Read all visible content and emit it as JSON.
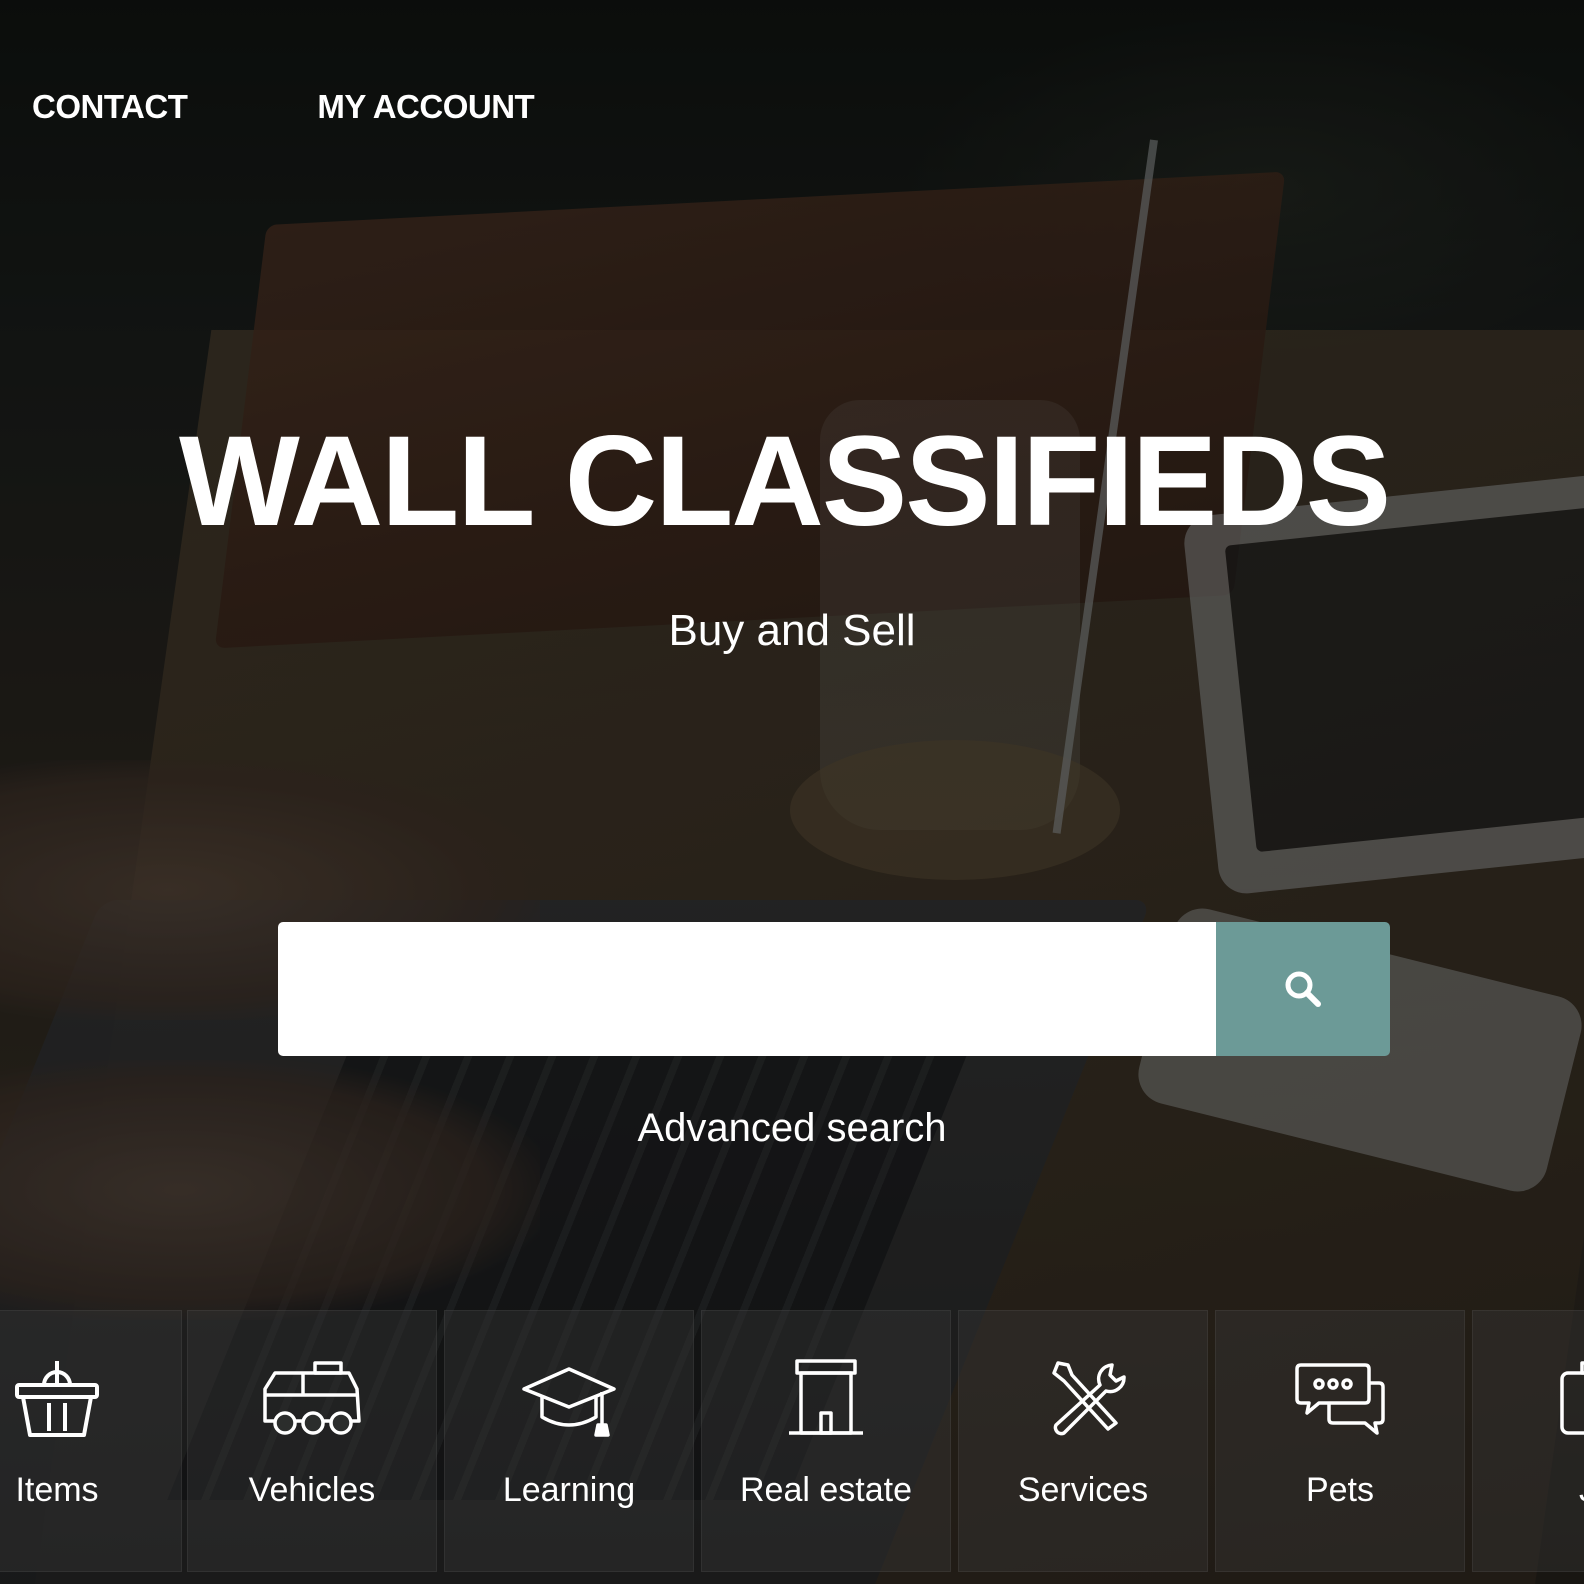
{
  "nav": {
    "contact_label": "CONTACT",
    "account_label": "MY ACCOUNT"
  },
  "hero": {
    "title": "WALL CLASSIFIEDS",
    "tagline": "Buy and Sell"
  },
  "search": {
    "value": "",
    "placeholder": "",
    "button_icon": "search-icon",
    "advanced_label": "Advanced search"
  },
  "categories": [
    {
      "label": "Items",
      "icon": "basket-icon"
    },
    {
      "label": "Vehicles",
      "icon": "car-icon"
    },
    {
      "label": "Learning",
      "icon": "graduation-cap-icon"
    },
    {
      "label": "Real estate",
      "icon": "building-icon"
    },
    {
      "label": "Services",
      "icon": "tools-icon"
    },
    {
      "label": "Pets",
      "icon": "chat-bubbles-icon"
    },
    {
      "label": "Je",
      "icon": "briefcase-icon"
    }
  ],
  "colors": {
    "accent": "#6c9a97",
    "text": "#ffffff",
    "input_bg": "#ffffff"
  }
}
